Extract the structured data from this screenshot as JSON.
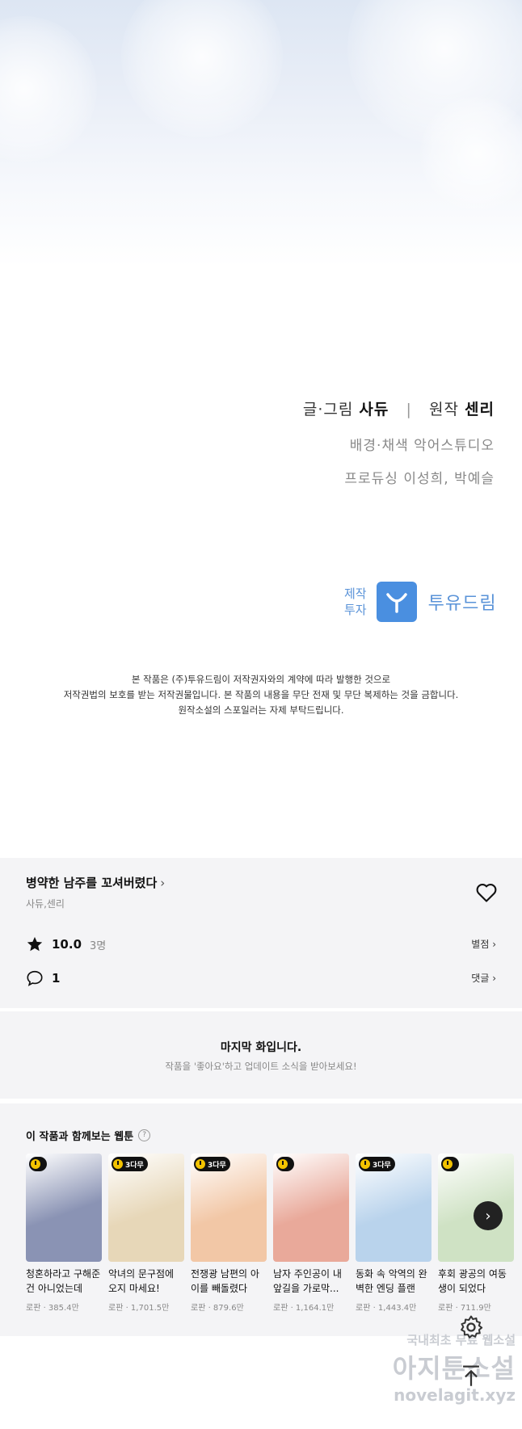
{
  "credits": {
    "writer_label": "글·그림",
    "writer": "사듀",
    "separator": "|",
    "original_label": "원작",
    "original": "센리",
    "bg_line": "배경·채색 악어스튜디오",
    "producer_line": "프로듀싱 이성희, 박예슬"
  },
  "production": {
    "label_1": "제작",
    "label_2": "투자",
    "company": "투유드림",
    "logo_color": "#4a8fe0"
  },
  "notice": [
    "본 작품은 (주)투유드림이 저작권자와의 계약에 따라 발행한 것으로",
    "저작권법의 보호를 받는 저작권물입니다. 본 작품의 내용을 무단 전재 및 무단 복제하는 것을 금합니다.",
    "원작소설의 스포일러는 자제 부탁드립니다."
  ],
  "work": {
    "title": "병약한 남주를 꼬셔버렸다",
    "title_chevron": "›",
    "authors": "사듀,센리",
    "rating": "10.0",
    "rating_count": "3명",
    "rating_link": "별점 ›",
    "comments": "1",
    "comments_link": "댓글 ›"
  },
  "last_episode": {
    "title": "마지막 화입니다.",
    "subtitle": "작품을 '좋아요'하고 업데이트 소식을 받아보세요!"
  },
  "recommend": {
    "heading": "이 작품과 함께보는 웹툰",
    "help": "?",
    "items": [
      {
        "title": "청혼하라고 구해준 건 아니었는데",
        "meta": "로판 · 385.4만",
        "badge": "",
        "color": "#8a93b4"
      },
      {
        "title": "악녀의 문구점에 오지 마세요!",
        "meta": "로판 · 1,701.5만",
        "badge": "3다무",
        "color": "#e7d7b8"
      },
      {
        "title": "전쟁광 남편의 아이를 빼돌렸다",
        "meta": "로판 · 879.6만",
        "badge": "3다무",
        "color": "#f2c7a6"
      },
      {
        "title": "남자 주인공이 내 앞길을 가로막...",
        "meta": "로판 · 1,164.1만",
        "badge": "",
        "color": "#e9a99a"
      },
      {
        "title": "동화 속 악역의 완벽한 엔딩 플랜",
        "meta": "로판 · 1,443.4만",
        "badge": "3다무",
        "color": "#b9d3ec"
      },
      {
        "title": "후회 광공의 여동생이 되었다",
        "meta": "로판 · 711.9만",
        "badge": "",
        "color": "#cfe2c4"
      }
    ],
    "next": "›"
  },
  "watermark": {
    "line1": "국내최초 무료 웹소설",
    "line2": "아지툰소설",
    "line3": "novelagit.xyz"
  }
}
